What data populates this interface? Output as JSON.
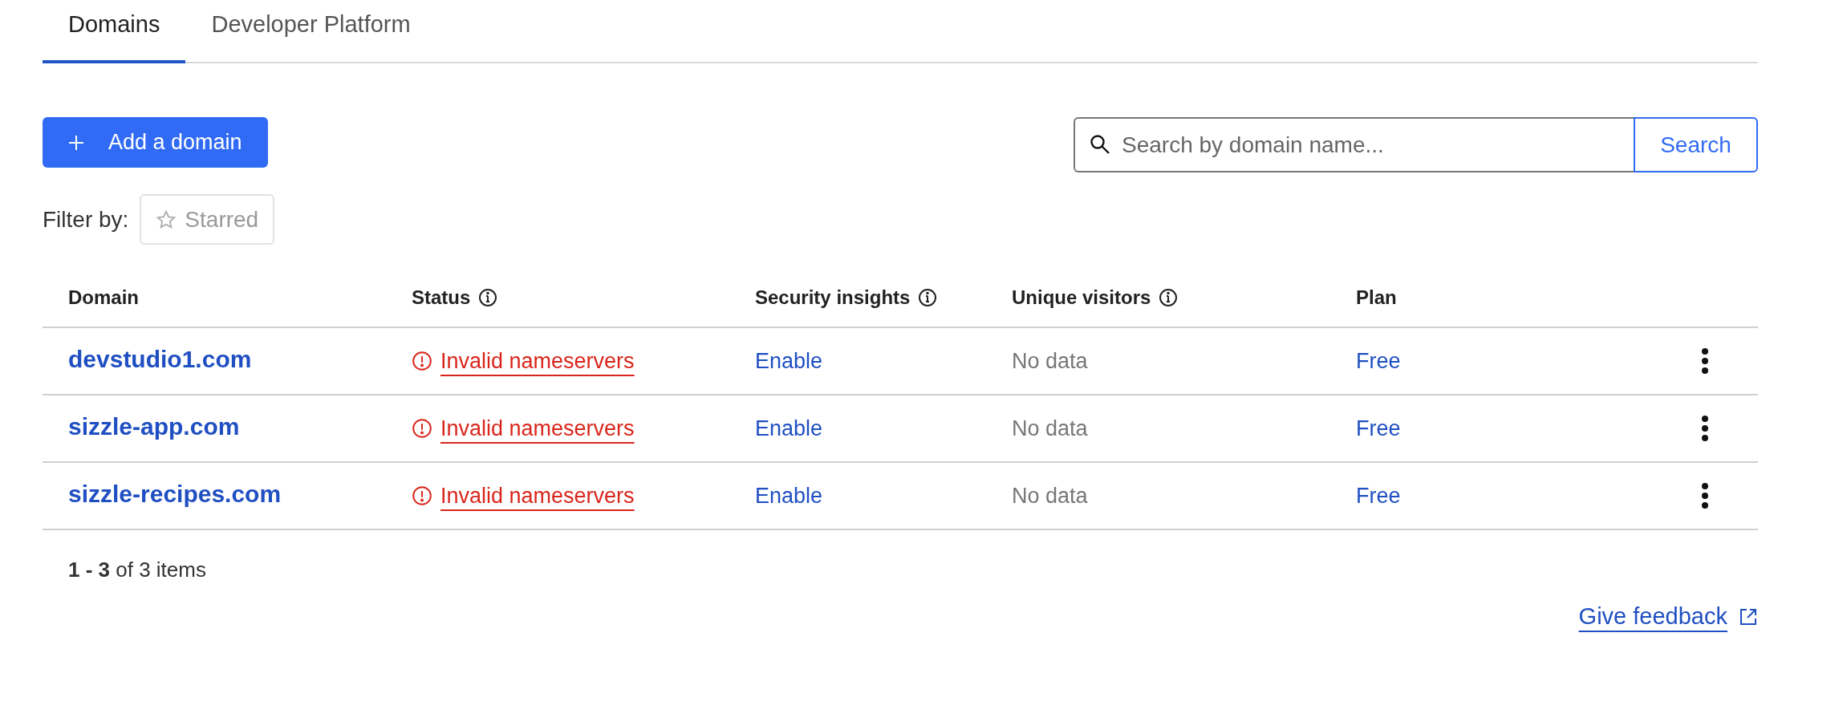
{
  "tabs": [
    {
      "label": "Domains",
      "selected": true
    },
    {
      "label": "Developer Platform",
      "selected": false
    }
  ],
  "add_button": {
    "label": "Add a domain"
  },
  "search": {
    "placeholder": "Search by domain name...",
    "button": "Search"
  },
  "filter": {
    "label": "Filter by:",
    "chips": [
      {
        "label": "Starred",
        "selected": false
      }
    ]
  },
  "table": {
    "columns": [
      {
        "label": "Domain",
        "info": false
      },
      {
        "label": "Status",
        "info": true
      },
      {
        "label": "Security insights",
        "info": true
      },
      {
        "label": "Unique visitors",
        "info": true
      },
      {
        "label": "Plan",
        "info": false
      }
    ],
    "rows": [
      {
        "domain": "devstudio1.com",
        "status": {
          "kind": "error",
          "text": "Invalid nameservers"
        },
        "security": "Enable",
        "visitors": "No data",
        "plan": "Free"
      },
      {
        "domain": "sizzle-app.com",
        "status": {
          "kind": "error",
          "text": "Invalid nameservers"
        },
        "security": "Enable",
        "visitors": "No data",
        "plan": "Free"
      },
      {
        "domain": "sizzle-recipes.com",
        "status": {
          "kind": "error",
          "text": "Invalid nameservers"
        },
        "security": "Enable",
        "visitors": "No data",
        "plan": "Free"
      }
    ]
  },
  "pagination": "**1 - 3** of 3 items",
  "feedback_link": "Give feedback"
}
